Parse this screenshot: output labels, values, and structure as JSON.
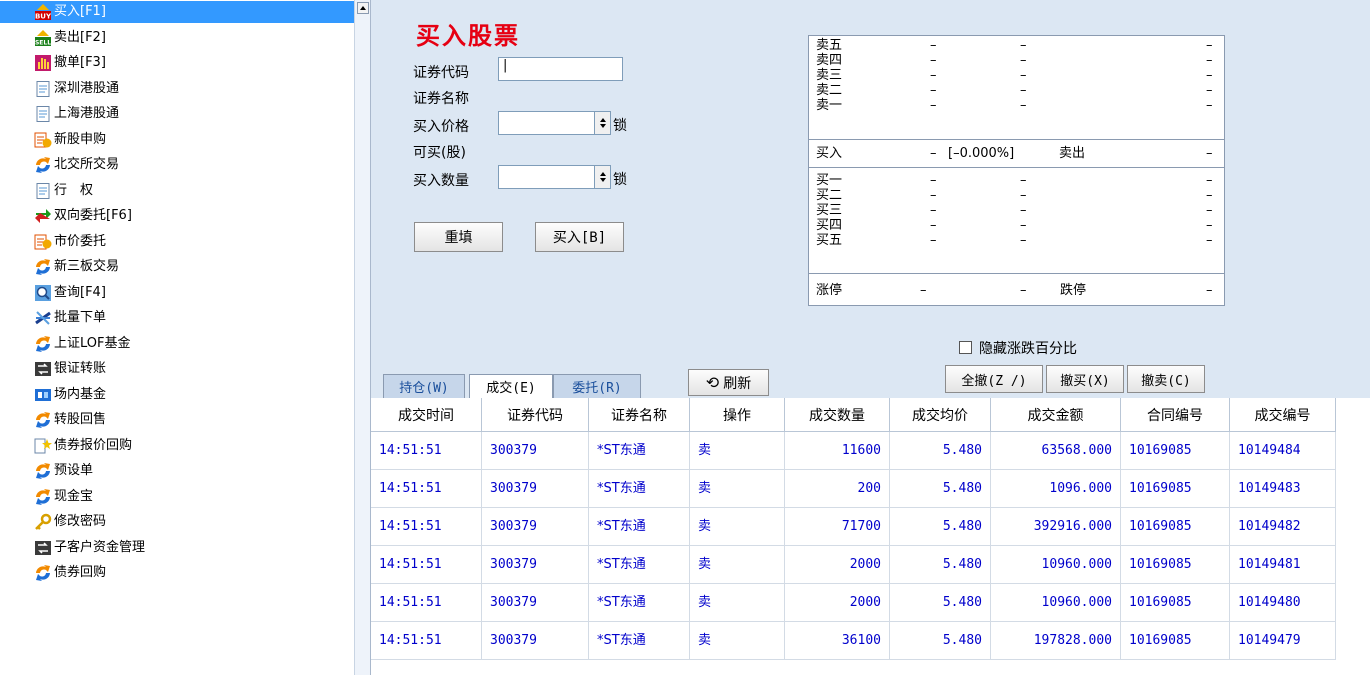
{
  "sidebar": {
    "items": [
      {
        "label": "买入[F1]",
        "icon": "buy-icon",
        "selected": true
      },
      {
        "label": "卖出[F2]",
        "icon": "sell-icon"
      },
      {
        "label": "撤单[F3]",
        "icon": "hand-icon"
      },
      {
        "label": "深圳港股通",
        "icon": "document-icon"
      },
      {
        "label": "上海港股通",
        "icon": "document-icon"
      },
      {
        "label": "新股申购",
        "icon": "new-stock-icon"
      },
      {
        "label": "北交所交易",
        "icon": "exchange-icon"
      },
      {
        "label": "行　权",
        "icon": "document-icon"
      },
      {
        "label": "双向委托[F6]",
        "icon": "two-way-icon"
      },
      {
        "label": "市价委托",
        "icon": "market-order-icon"
      },
      {
        "label": "新三板交易",
        "icon": "exchange-icon"
      },
      {
        "label": "查询[F4]",
        "icon": "magnifier-icon"
      },
      {
        "label": "批量下单",
        "icon": "batch-icon"
      },
      {
        "label": "上证LOF基金",
        "icon": "exchange-icon"
      },
      {
        "label": "银证转账",
        "icon": "transfer-icon"
      },
      {
        "label": "场内基金",
        "icon": "fund-icon"
      },
      {
        "label": "转股回售",
        "icon": "exchange-icon"
      },
      {
        "label": "债券报价回购",
        "icon": "bond-star-icon"
      },
      {
        "label": "预设单",
        "icon": "exchange-icon"
      },
      {
        "label": "现金宝",
        "icon": "exchange-icon"
      },
      {
        "label": "修改密码",
        "icon": "key-icon"
      },
      {
        "label": "子客户资金管理",
        "icon": "transfer-icon"
      },
      {
        "label": "债券回购",
        "icon": "exchange-icon"
      }
    ]
  },
  "form": {
    "title": "买入股票",
    "code_label": "证券代码",
    "code_value": "|",
    "name_label": "证券名称",
    "price_label": "买入价格",
    "price_value": "",
    "lock_label": "锁",
    "canbuy_label": "可买(股)",
    "qty_label": "买入数量",
    "qty_value": "",
    "reset_button": "重填",
    "buy_button": "买入[B]"
  },
  "quote": {
    "sell_rows": [
      {
        "label": "卖五",
        "p": "–",
        "v": "–",
        "t": "–"
      },
      {
        "label": "卖四",
        "p": "–",
        "v": "–",
        "t": "–"
      },
      {
        "label": "卖三",
        "p": "–",
        "v": "–",
        "t": "–"
      },
      {
        "label": "卖二",
        "p": "–",
        "v": "–",
        "t": "–"
      },
      {
        "label": "卖一",
        "p": "–",
        "v": "–",
        "t": "–"
      }
    ],
    "mid": {
      "buy_label": "买入",
      "dash": "–",
      "pct": "[–0.000%]",
      "sell_label": "卖出",
      "sell_val": "–"
    },
    "buy_rows": [
      {
        "label": "买一",
        "p": "–",
        "v": "–",
        "t": "–"
      },
      {
        "label": "买二",
        "p": "–",
        "v": "–",
        "t": "–"
      },
      {
        "label": "买三",
        "p": "–",
        "v": "–",
        "t": "–"
      },
      {
        "label": "买四",
        "p": "–",
        "v": "–",
        "t": "–"
      },
      {
        "label": "买五",
        "p": "–",
        "v": "–",
        "t": "–"
      }
    ],
    "limit": {
      "up_label": "涨停",
      "up_a": "–",
      "up_b": "–",
      "down_label": "跌停",
      "down_val": "–"
    }
  },
  "options": {
    "hide_pct_label": "隐藏涨跌百分比",
    "cancel_all": "全撤(Z /)",
    "cancel_buy": "撤买(X)",
    "cancel_sell": "撤卖(C)",
    "refresh": "刷新"
  },
  "tabs": [
    {
      "label": "持仓(W)",
      "active": false
    },
    {
      "label": "成交(E)",
      "active": true
    },
    {
      "label": "委托(R)",
      "active": false
    }
  ],
  "table": {
    "columns": [
      "成交时间",
      "证券代码",
      "证券名称",
      "操作",
      "成交数量",
      "成交均价",
      "成交金额",
      "合同编号",
      "成交编号"
    ],
    "rows": [
      [
        "14:51:51",
        "300379",
        "*ST东通",
        "卖",
        "11600",
        "5.480",
        "63568.000",
        "10169085",
        "10149484"
      ],
      [
        "14:51:51",
        "300379",
        "*ST东通",
        "卖",
        "200",
        "5.480",
        "1096.000",
        "10169085",
        "10149483"
      ],
      [
        "14:51:51",
        "300379",
        "*ST东通",
        "卖",
        "71700",
        "5.480",
        "392916.000",
        "10169085",
        "10149482"
      ],
      [
        "14:51:51",
        "300379",
        "*ST东通",
        "卖",
        "2000",
        "5.480",
        "10960.000",
        "10169085",
        "10149481"
      ],
      [
        "14:51:51",
        "300379",
        "*ST东通",
        "卖",
        "2000",
        "5.480",
        "10960.000",
        "10169085",
        "10149480"
      ],
      [
        "14:51:51",
        "300379",
        "*ST东通",
        "卖",
        "36100",
        "5.480",
        "197828.000",
        "10169085",
        "10149479"
      ]
    ]
  }
}
